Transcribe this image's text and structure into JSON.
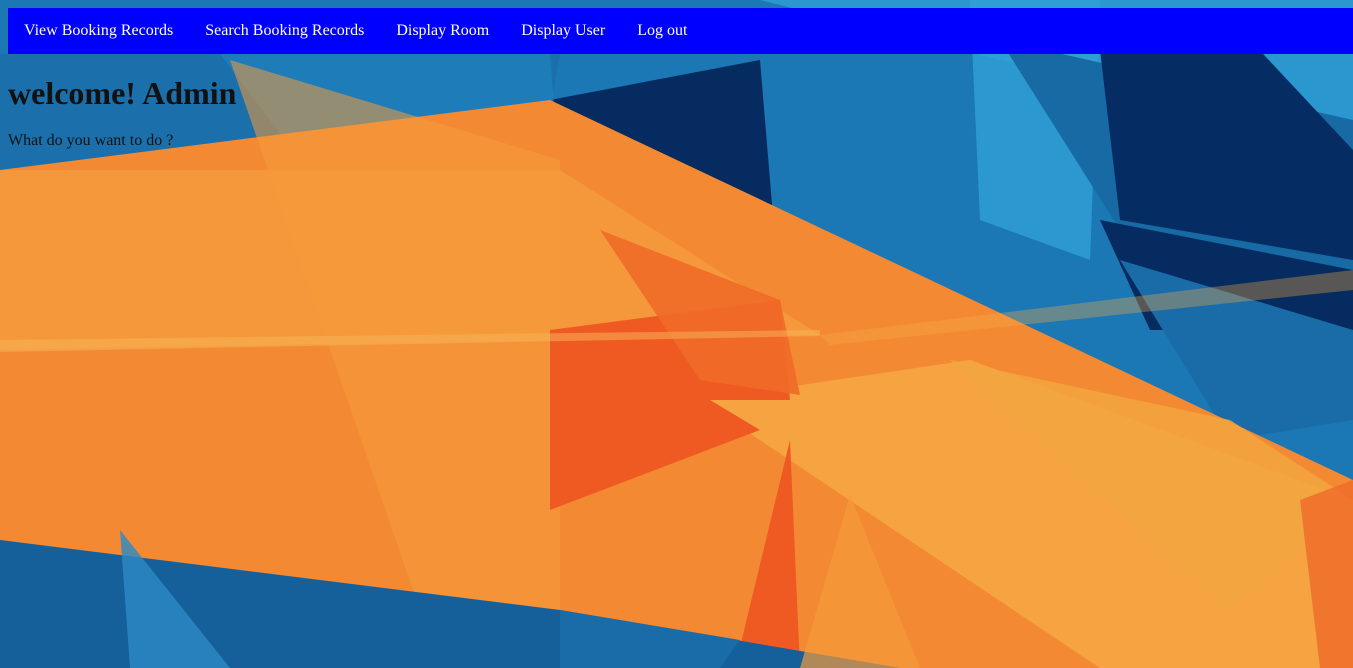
{
  "nav": {
    "items": [
      {
        "label": "View Booking Records"
      },
      {
        "label": "Search Booking Records"
      },
      {
        "label": "Display Room"
      },
      {
        "label": "Display User"
      },
      {
        "label": "Log out"
      }
    ]
  },
  "main": {
    "heading": "welcome! Admin",
    "prompt": "What do you want to do ?"
  },
  "colors": {
    "navbar": "#0000ff",
    "nav_text": "#ffffff",
    "bg_blue": "#1a73b0",
    "bg_dark_blue": "#062d63",
    "bg_orange": "#f38a33",
    "bg_red_orange": "#ef5a22"
  }
}
